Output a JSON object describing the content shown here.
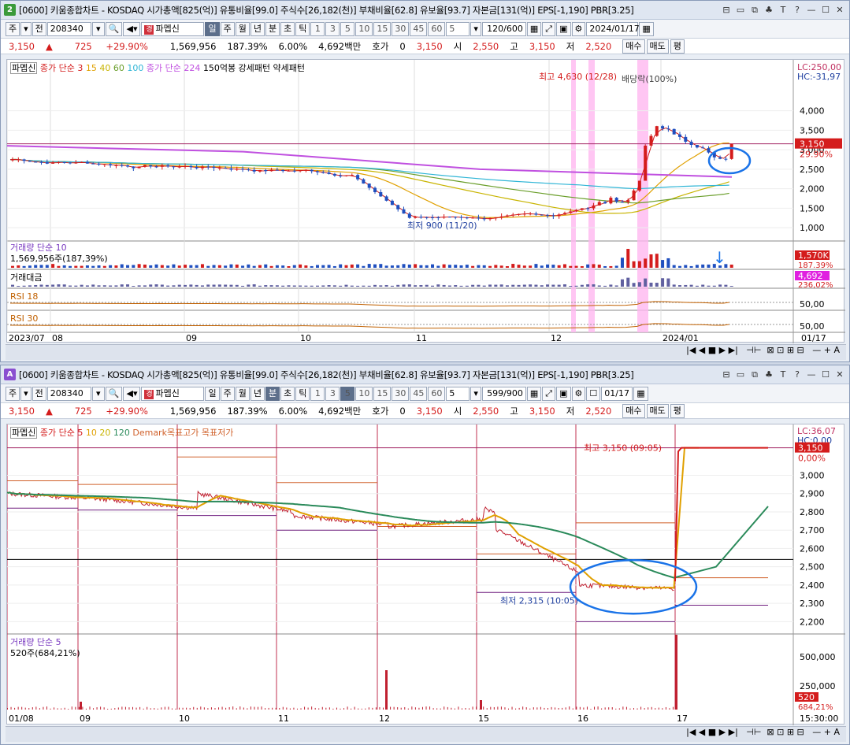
{
  "win1": {
    "num": "2",
    "title": "[0600] 키움종합차트 - KOSDAQ 시가총액[825(억)] 유통비율[99.0] 주식수[26,182(천)] 부채비율[62.8] 유보율[93.7] 자본금[131(억)] EPS[-1,190] PBR[3.25]",
    "ctrls": [
      "⊟",
      "ㅁ",
      "⧉",
      "♣",
      "T",
      "?",
      "—",
      "ㅁ",
      "✕"
    ],
    "toolbar": {
      "type": "주",
      "prefix": "전",
      "code": "208340",
      "name": "파멥신",
      "periods": [
        "일",
        "주",
        "월",
        "년",
        "분",
        "초",
        "틱"
      ],
      "active_period": "일",
      "nums": [
        "1",
        "3",
        "5",
        "10",
        "15",
        "30",
        "45",
        "60",
        "5"
      ],
      "count": "120/600",
      "date": "2024/01/17"
    },
    "quote": {
      "price": "3,150",
      "arrow": "▲",
      "change": "725",
      "pct": "+29.90%",
      "volume": "1,569,956",
      "vol_pct": "187.39%",
      "turnover": "6.00%",
      "amount": "4,692백만",
      "hoga": "호가",
      "hoga_val": "0",
      "cur": "3,150",
      "open_l": "시",
      "open": "2,550",
      "high_l": "고",
      "high": "3,150",
      "low_l": "저",
      "low": "2,520",
      "buy": "매수",
      "sell": "매도",
      "avg": "평"
    },
    "legend": {
      "name": "파멥신",
      "ma": "종가 단순",
      "ma_vals": [
        "3",
        "15",
        "40",
        "60",
        "100"
      ],
      "ma2": "종가 단순 224",
      "extra": "150억봉 강세패턴  약세패턴"
    },
    "annot": {
      "high": "최고 4,630 (12/28)",
      "low": "최저 900 (11/20)",
      "div": "배당락(100%)"
    },
    "right": {
      "lc": "LC:250,00",
      "hc": "HC:-31,97",
      "price": "3,150",
      "pct": "29.90%"
    },
    "yticks": [
      "4,000",
      "3,500",
      "3,000",
      "2,500",
      "2,000",
      "1,500",
      "1,000"
    ],
    "vol": {
      "label": "거래량",
      "ma": "단순 10",
      "val": "1,569,956주(187,39%)",
      "tag": "1,570K",
      "tag2": "187.39%"
    },
    "amt": {
      "label": "거래대금",
      "tag": "4,692",
      "tag2": "236,02%"
    },
    "rsi18": {
      "label": "RSI 18",
      "tick": "50,00"
    },
    "rsi30": {
      "label": "RSI 30",
      "tick": "50,00"
    },
    "xticks": [
      "2023/07",
      "08",
      "09",
      "10",
      "11",
      "12",
      "2024/01"
    ],
    "last_date": "01/17"
  },
  "win2": {
    "num": "A",
    "title": "[0600] 키움종합차트 - KOSDAQ 시가총액[825(억)] 유통비율[99.0] 주식수[26,182(천)] 부채비율[62.8] 유보율[93.7] 자본금[131(억)] EPS[-1,190] PBR[3.25]",
    "toolbar": {
      "type": "주",
      "prefix": "전",
      "code": "208340",
      "name": "파멥신",
      "periods": [
        "일",
        "주",
        "월",
        "년",
        "분",
        "초",
        "틱"
      ],
      "active_period": "분",
      "nums": [
        "1",
        "3",
        "5",
        "10",
        "15",
        "30",
        "45",
        "60",
        "5"
      ],
      "count": "599/900",
      "date": "01/17"
    },
    "legend": {
      "name": "파멥신",
      "ma": "종가 단순",
      "ma_vals": [
        "5",
        "10",
        "20",
        "120"
      ],
      "extra": "Demark목표고가  목표저가"
    },
    "annot": {
      "high": "최고 3,150 (09:05)",
      "low": "최저 2,315 (10:05)"
    },
    "right": {
      "lc": "LC:36,07",
      "hc": "HC:0,00",
      "price": "3,150",
      "pct": "0,00%"
    },
    "yticks": [
      "3,000",
      "2,900",
      "2,800",
      "2,700",
      "2,600",
      "2,500",
      "2,400",
      "2,300",
      "2,200"
    ],
    "vol": {
      "label": "거래량",
      "ma": "단순 5",
      "val": "520주(684,21%)",
      "ticks": [
        "500,000",
        "250,000"
      ],
      "tag": "520",
      "tag2": "684,21%"
    },
    "xticks": [
      "01/08",
      "09",
      "10",
      "11",
      "12",
      "15",
      "16",
      "17"
    ],
    "time": "15:30:00"
  },
  "colors": {
    "up": "#d41c1c",
    "down": "#1f4fbf",
    "ma3": "#d41c1c",
    "ma15": "#e0a000",
    "ma40": "#c8b400",
    "ma60": "#6a9e2a",
    "ma100": "#2fb5d6",
    "ma224": "#c050e0",
    "highlight": "#ffb8f0",
    "circle": "#1a73e8"
  }
}
